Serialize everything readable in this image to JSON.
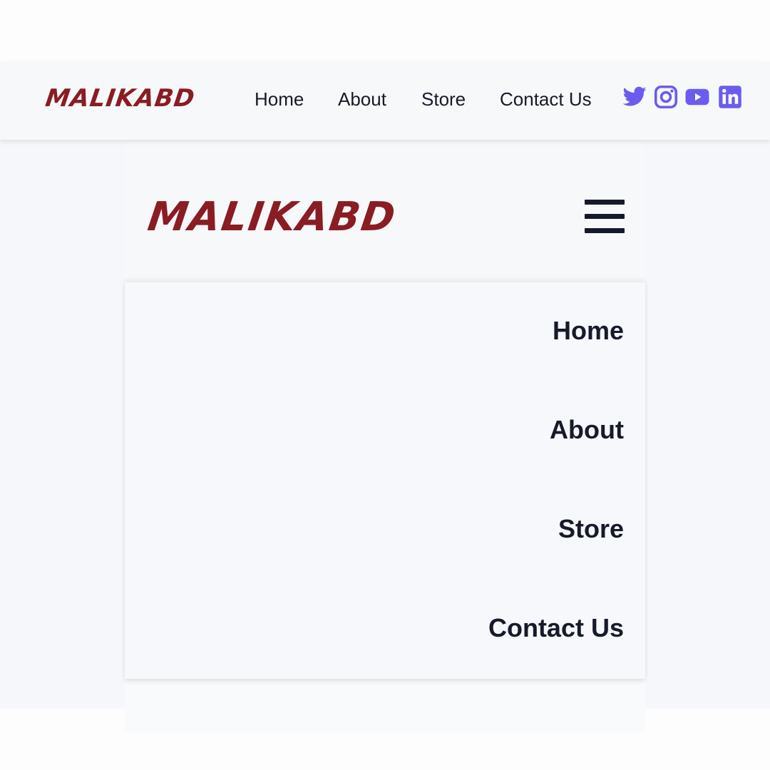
{
  "brand": {
    "name": "MALIKABD",
    "color": "#8a1c24"
  },
  "desktop_nav": {
    "links": [
      {
        "label": "Home"
      },
      {
        "label": "About"
      },
      {
        "label": "Store"
      },
      {
        "label": "Contact Us"
      }
    ],
    "social_icons": [
      "twitter-icon",
      "instagram-icon",
      "youtube-icon",
      "linkedin-icon"
    ],
    "social_color": "#6b5cf0"
  },
  "mobile_nav": {
    "menu_icon": "hamburger-icon",
    "links": [
      {
        "label": "Home"
      },
      {
        "label": "About"
      },
      {
        "label": "Store"
      },
      {
        "label": "Contact Us"
      }
    ]
  }
}
